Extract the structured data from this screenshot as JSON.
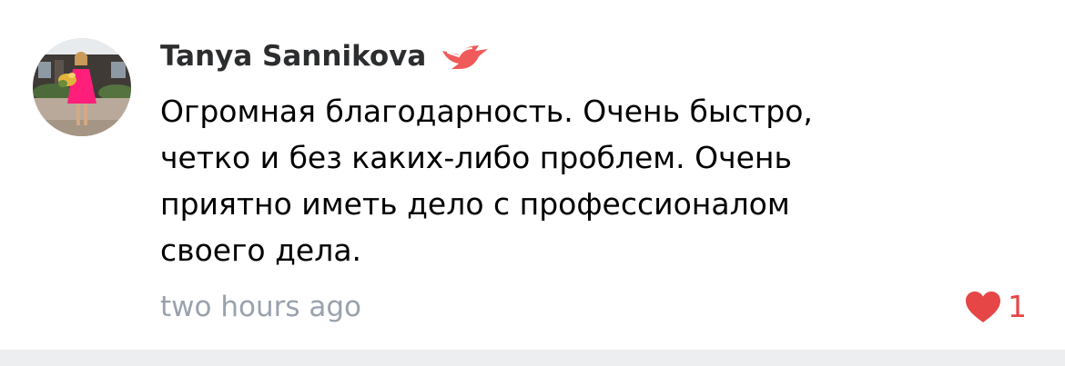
{
  "comment": {
    "author": "Tanya Sannikova",
    "text": "Огромная благодарность. Очень быстро,\nчетко и без каких-либо проблем. Очень\nприятно иметь дело с профессионалом\nсвоего дела.",
    "timestamp": "two hours ago",
    "likes": "1",
    "badge_icon": "bird-icon",
    "like_icon": "heart-icon"
  },
  "colors": {
    "author": "#2c2d2e",
    "text": "#000000",
    "timestamp": "#99a2ad",
    "like": "#e64646",
    "badge": "#f05a5a",
    "separator": "#edeef0"
  }
}
